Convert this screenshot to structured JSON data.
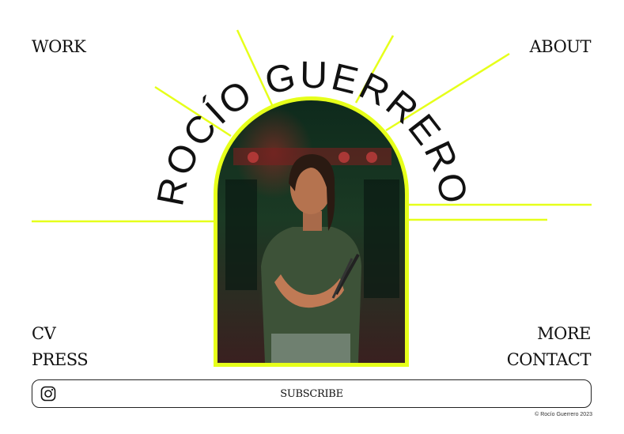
{
  "site": {
    "title": "ROCÍO GUERRERO",
    "accent": "#e6ff1a"
  },
  "nav": {
    "work": "WORK",
    "about": "ABOUT",
    "cv": "CV",
    "press": "PRESS",
    "more": "MORE",
    "contact": "CONTACT"
  },
  "footer": {
    "social_icon": "instagram-icon",
    "subscribe": "SUBSCRIBE",
    "copyright": "© Rocío Guerrero 2023"
  }
}
